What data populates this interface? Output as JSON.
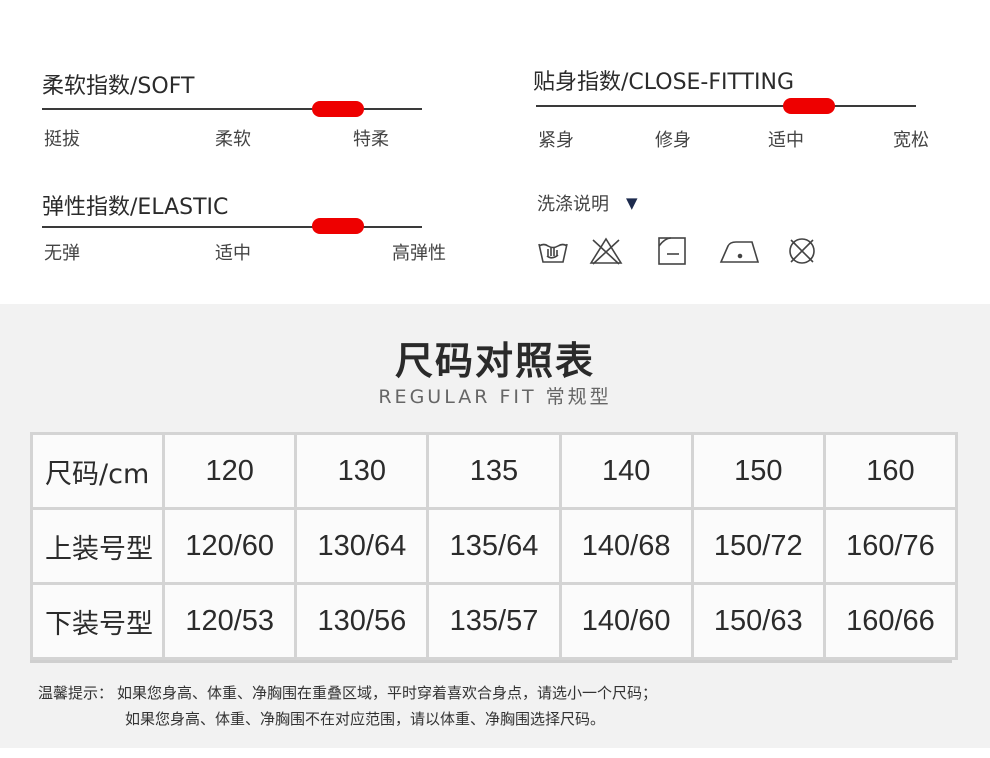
{
  "soft": {
    "title": "柔软指数/SOFT",
    "labels": [
      "挺拔",
      "柔软",
      "特柔"
    ]
  },
  "fitting": {
    "title": "贴身指数/CLOSE-FITTING",
    "labels": [
      "紧身",
      "修身",
      "适中",
      "宽松"
    ]
  },
  "elastic": {
    "title": "弹性指数/ELASTIC",
    "labels": [
      "无弹",
      "适中",
      "高弹性"
    ]
  },
  "wash": {
    "title": "洗涤说明",
    "arrow": "▼",
    "icons": [
      "hand-wash-icon",
      "no-bleach-icon",
      "tumble-dry-icon",
      "iron-icon",
      "no-dry-clean-icon"
    ]
  },
  "marker_color": "#ee0000",
  "chart": {
    "title": "尺码对照表",
    "subtitle": "REGULAR FIT 常规型",
    "rows": [
      [
        "尺码/cm",
        "120",
        "130",
        "135",
        "140",
        "150",
        "160"
      ],
      [
        "上装号型",
        "120/60",
        "130/64",
        "135/64",
        "140/68",
        "150/72",
        "160/76"
      ],
      [
        "下装号型",
        "120/53",
        "130/56",
        "135/57",
        "140/60",
        "150/63",
        "160/66"
      ]
    ]
  },
  "tips": {
    "label": "温馨提示：",
    "line1": "如果您身高、体重、净胸围在重叠区域，平时穿着喜欢合身点，请选小一个尺码；",
    "line2": "如果您身高、体重、净胸围不在对应范围，请以体重、净胸围选择尺码。"
  }
}
